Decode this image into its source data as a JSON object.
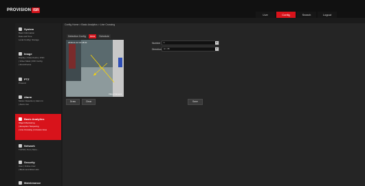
{
  "brand": {
    "name": "PROVISION",
    "badge": "ISR"
  },
  "topnav": [
    {
      "label": "Live",
      "active": false
    },
    {
      "label": "Config",
      "active": true
    },
    {
      "label": "Search",
      "active": false
    },
    {
      "label": "Logout",
      "active": false
    }
  ],
  "sidebar": [
    {
      "title": "System",
      "sub": [
        "Basic Information",
        "Date and Time",
        "Local Config | Storage"
      ],
      "active": false
    },
    {
      "title": "Image",
      "sub": [
        "Display | Video/Audio | OSD",
        "| Video Mask | ROI Config",
        "| Zoom/Focus"
      ],
      "active": false
    },
    {
      "title": "PTZ",
      "sub": [
        "Protocol"
      ],
      "active": false
    },
    {
      "title": "Alarm",
      "sub": [
        "Motion Detection | Alarm In",
        "| Alarm Out"
      ],
      "active": false
    },
    {
      "title": "Basic Analytics",
      "sub": [
        "Object Monitoring",
        "| Exception Tampering",
        "| Line Crossing | Intrusion Area"
      ],
      "active": true
    },
    {
      "title": "Network",
      "sub": [
        "TCP/IP | Port | More..."
      ],
      "active": false
    },
    {
      "title": "Security",
      "sub": [
        "User | Online User",
        "| Block and Allow Lists"
      ],
      "active": false
    },
    {
      "title": "Maintenance",
      "sub": [],
      "active": false
    }
  ],
  "breadcrumb": "Config Home > Basic Analytics > Line Crossing",
  "tabs": [
    {
      "label": "Detection Config",
      "active": false
    },
    {
      "label": "Area",
      "active": true
    },
    {
      "label": "Schedule",
      "active": false
    }
  ],
  "video": {
    "timestamp": "2019-11-12 14:18:41",
    "camera_name": "Video Camera"
  },
  "video_buttons": {
    "draw": "Draw",
    "clear": "Clear"
  },
  "fields": {
    "number": {
      "label": "Number",
      "value": "1"
    },
    "direction": {
      "label": "Direction",
      "value": "A<->B"
    }
  },
  "save_label": "Save",
  "colors": {
    "accent": "#d8131b",
    "background": "#1b1b1b",
    "panel": "#252525"
  }
}
